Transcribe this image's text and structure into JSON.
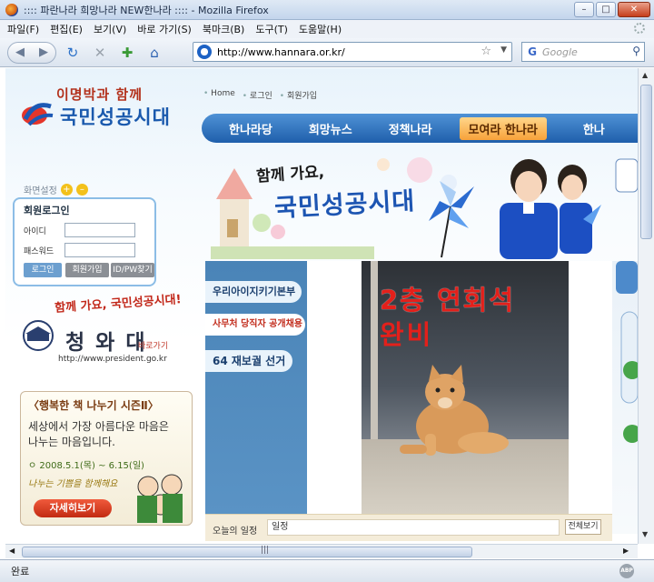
{
  "window": {
    "title": ":::: 파란나라 희망나라 NEW한나라 :::: - Mozilla Firefox"
  },
  "menu": [
    "파일(F)",
    "편집(E)",
    "보기(V)",
    "바로 가기(S)",
    "북마크(B)",
    "도구(T)",
    "도움말(H)"
  ],
  "navbar": {
    "url": "http://www.hannara.or.kr/",
    "search_placeholder": "Google"
  },
  "status": {
    "text": "완료",
    "addon": "ABP"
  },
  "site": {
    "logo_top": "이명박과 함께",
    "logo_main": "국민성공시대",
    "top_links": [
      "Home",
      "로그인",
      "회원가입"
    ],
    "gnb": [
      "한나라당",
      "희망뉴스",
      "정책나라",
      "모여라 한나라",
      "한나"
    ],
    "screen_setting": "화면설정",
    "login": {
      "title": "회원로그인",
      "id_label": "아이디",
      "pw_label": "패스워드",
      "login_btn": "로그인",
      "join_btn": "회원가입",
      "find_btn": "ID/PW찾기"
    },
    "cheongwadae": {
      "slogan": "함께 가요, 국민성공시대!",
      "name": "청 와 대",
      "sub": "바로가기",
      "url": "http://www.president.go.kr"
    },
    "book": {
      "heading": "〈행복한 책 나누기 시즌Ⅱ〉",
      "line1": "세상에서 가장 아름다운 마음은",
      "line2": "나누는 마음입니다.",
      "date": "ㅇ 2008.5.1(목) ~ 6.15(일)",
      "hand": "나누는 기쁨을 함께해요",
      "detail_btn": "자세히보기"
    },
    "banner": {
      "line1": "함께 가요,",
      "line2": "국민성공시대"
    },
    "side_menu": [
      "우리아이지키기본부",
      "사무처 당직자 공개채용",
      "64 재보궐 선거"
    ],
    "photo_sign": {
      "line1": "2층 연회석",
      "line2": "완비"
    },
    "schedule": {
      "label": "오늘의 일정",
      "value": "일정",
      "all_btn": "전체보기"
    }
  }
}
